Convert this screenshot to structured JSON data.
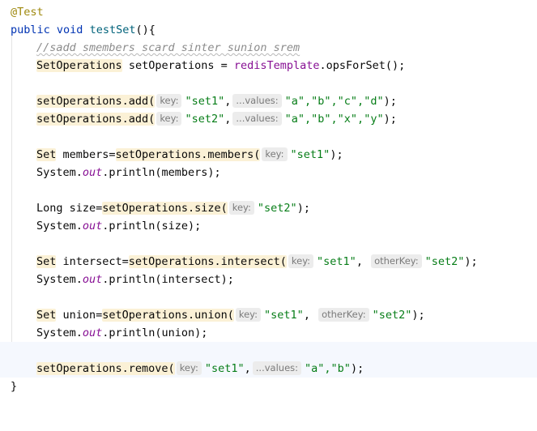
{
  "code": {
    "annotation": "@Test",
    "method": {
      "modifier": "public",
      "return_type": "void",
      "name": "testSet",
      "open": "(){"
    },
    "comment": "//sadd smembers scard sinter sunion srem",
    "declaration": {
      "type": "SetOperations",
      "var": "setOperations",
      "eq": " = ",
      "target": "redisTemplate",
      "call": ".opsForSet();"
    },
    "add1": {
      "call": "setOperations.add(",
      "hint_key": "key:",
      "key": "\"set1\"",
      "hint_values": "...values:",
      "values": "\"a\",\"b\",\"c\",\"d\"",
      "end": ");"
    },
    "add2": {
      "call": "setOperations.add(",
      "hint_key": "key:",
      "key": "\"set2\"",
      "hint_values": "...values:",
      "values": "\"a\",\"b\",\"x\",\"y\"",
      "end": ");"
    },
    "members": {
      "type": "Set",
      "lhs": " members=",
      "call": "setOperations.members(",
      "hint_key": "key:",
      "key": "\"set1\"",
      "end": ");"
    },
    "print_members": {
      "prefix": "System.",
      "field": "out",
      "suffix": ".println(members);"
    },
    "size": {
      "type": "Long",
      "lhs": " size=",
      "call": "setOperations.size(",
      "hint_key": "key:",
      "key": "\"set2\"",
      "end": ");"
    },
    "print_size": {
      "prefix": "System.",
      "field": "out",
      "suffix": ".println(size);"
    },
    "intersect": {
      "type": "Set",
      "lhs": " intersect=",
      "call": "setOperations.intersect(",
      "hint_key": "key:",
      "key": "\"set1\"",
      "sep": ", ",
      "hint_other": "otherKey:",
      "other": "\"set2\"",
      "end": ");"
    },
    "print_intersect": {
      "prefix": "System.",
      "field": "out",
      "suffix": ".println(intersect);"
    },
    "union": {
      "type": "Set",
      "lhs": " union=",
      "call": "setOperations.union(",
      "hint_key": "key:",
      "key": "\"set1\"",
      "sep": ", ",
      "hint_other": "otherKey:",
      "other": "\"set2\"",
      "end": ");"
    },
    "print_union": {
      "prefix": "System.",
      "field": "out",
      "suffix": ".println(union);"
    },
    "remove": {
      "call": "setOperations.remove(",
      "hint_key": "key:",
      "key": "\"set1\"",
      "hint_values": "...values:",
      "values": "\"a\",\"b\"",
      "end": ");"
    },
    "close": "}"
  },
  "colors": {
    "keyword": "#0033b3",
    "method_name": "#00627a",
    "string": "#067d17",
    "comment": "#8c8c8c",
    "static_field": "#871094",
    "annotation": "#9e880d",
    "usage_highlight": "#fbf1d6",
    "current_line": "#f5f8fe"
  }
}
